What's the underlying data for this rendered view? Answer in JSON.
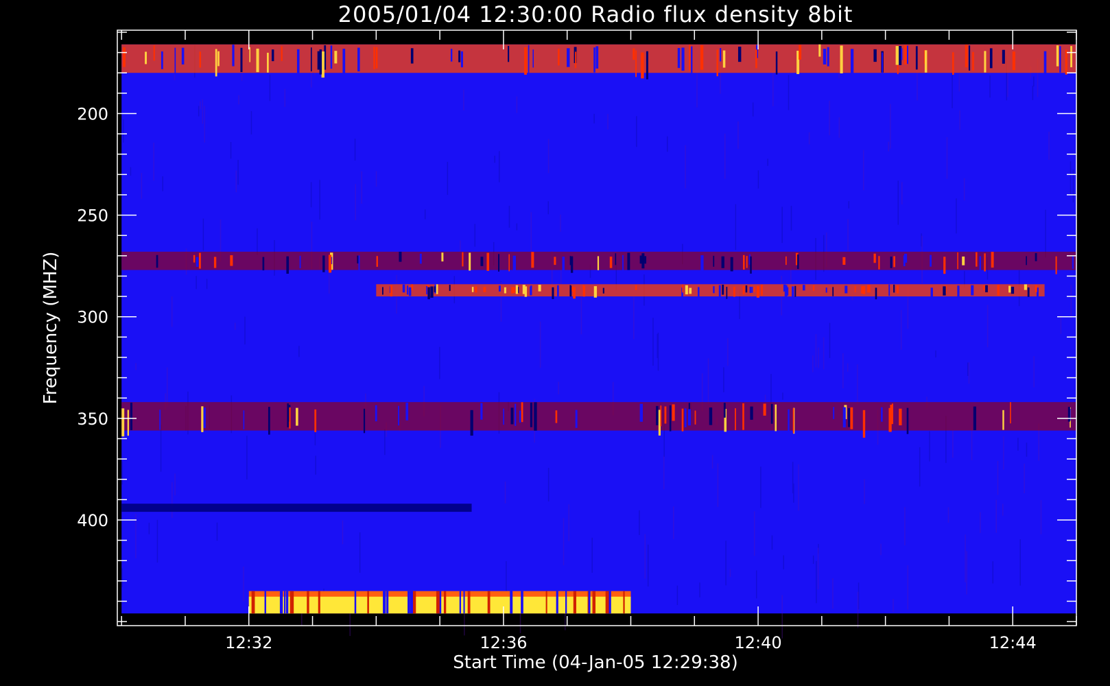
{
  "chart_data": {
    "type": "heatmap",
    "title": "2005/01/04 12:30:00 Radio flux density 8bit",
    "xlabel": "Start Time (04-Jan-05 12:29:38)",
    "ylabel": "Frequency (MHZ)",
    "x_axis": {
      "unit": "time",
      "tick_labels": [
        "12:32",
        "12:36",
        "12:40",
        "12:44"
      ],
      "range": [
        "12:29:56",
        "12:45:00"
      ],
      "data_start": "12:30:00",
      "data_end": "12:45:00"
    },
    "y_axis": {
      "unit": "MHz",
      "inverted": true,
      "range": [
        159,
        452
      ],
      "data_range": [
        166,
        446
      ],
      "major_ticks": [
        200,
        250,
        300,
        350,
        400
      ],
      "minor_step": 10
    },
    "colormap": {
      "background": "#1a10f5",
      "low": "#000080",
      "mid": "#a00000",
      "high": "#ff4000",
      "peak": "#ffff40"
    },
    "features": [
      {
        "name": "upper band interference",
        "freq": [
          166,
          180
        ],
        "time": [
          "12:30:00",
          "12:45:00"
        ],
        "intensity": "high"
      },
      {
        "name": "red band",
        "freq": [
          268,
          277
        ],
        "time": [
          "12:30:00",
          "12:45:00"
        ],
        "intensity": "mid"
      },
      {
        "name": "spots",
        "freq": [
          284,
          290
        ],
        "time": [
          "12:34:00",
          "12:44:30"
        ],
        "intensity": "high"
      },
      {
        "name": "red band",
        "freq": [
          342,
          356
        ],
        "time": [
          "12:30:00",
          "12:45:00"
        ],
        "intensity": "mid"
      },
      {
        "name": "dark line",
        "freq": [
          392,
          396
        ],
        "time": [
          "12:30:00",
          "12:35:30"
        ],
        "intensity": "low"
      },
      {
        "name": "bright bottom burst",
        "freq": [
          435,
          446
        ],
        "time": [
          "12:32:00",
          "12:38:00"
        ],
        "intensity": "peak"
      }
    ]
  }
}
